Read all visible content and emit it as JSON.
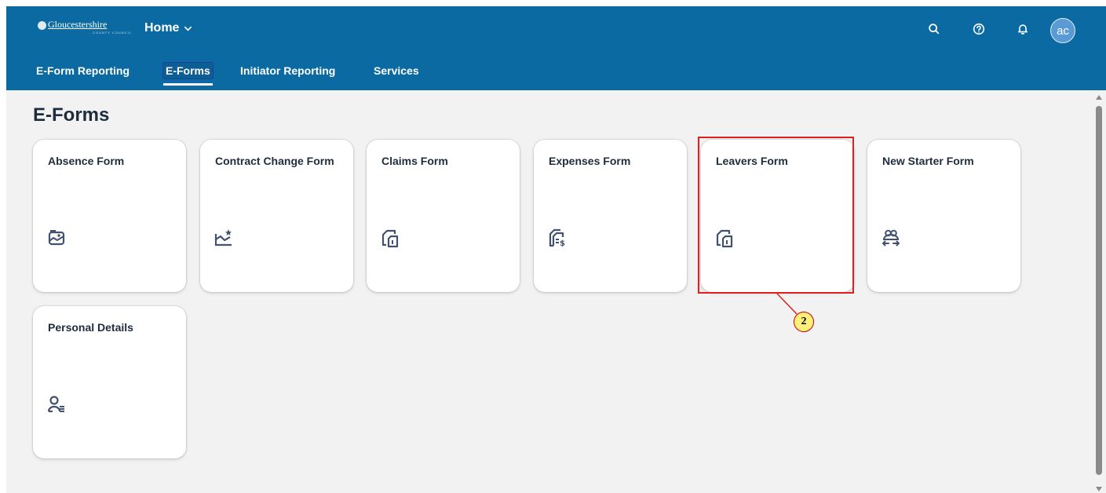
{
  "shell": {
    "logo_text": "Gloucestershire",
    "logo_sub": "COUNTY COUNCIL",
    "home_label": "Home",
    "avatar_initials": "ac",
    "icons": [
      "search-icon",
      "help-icon",
      "notifications-icon"
    ]
  },
  "tabs": [
    {
      "label": "E-Form Reporting",
      "active": false
    },
    {
      "label": "E-Forms",
      "active": true
    },
    {
      "label": "Initiator Reporting",
      "active": false
    },
    {
      "label": "Services",
      "active": false
    }
  ],
  "main": {
    "title": "E-Forms",
    "tiles": [
      {
        "title": "Absence Form",
        "icon": "image-folder-icon"
      },
      {
        "title": "Contract Change Form",
        "icon": "chart-star-icon"
      },
      {
        "title": "Claims Form",
        "icon": "document-copy-icon"
      },
      {
        "title": "Expenses Form",
        "icon": "expense-document-icon"
      },
      {
        "title": "Leavers Form",
        "icon": "document-copy-icon"
      },
      {
        "title": "New Starter Form",
        "icon": "group-transfer-icon"
      },
      {
        "title": "Personal Details",
        "icon": "person-list-icon"
      }
    ]
  },
  "annotation": {
    "step_number": "2",
    "color": "#e02020"
  },
  "colors": {
    "shell": "#0a6aa1",
    "background": "#f2f2f2",
    "text": "#1d2d3e"
  }
}
